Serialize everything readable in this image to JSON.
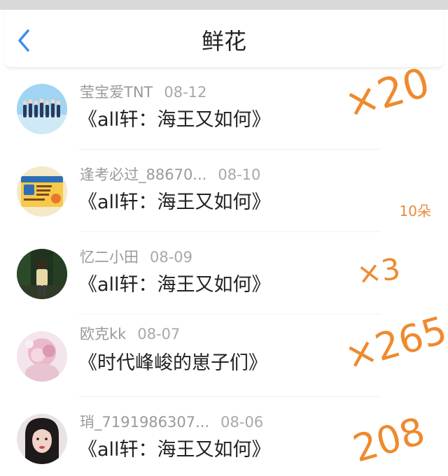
{
  "header": {
    "title": "鲜花",
    "back_icon": "chevron-left-icon"
  },
  "colors": {
    "accent_blue": "#3a8ef0",
    "annotation_orange": "#ef8a2e",
    "quantity_orange": "#e98a3a"
  },
  "items": [
    {
      "user": "莹宝爱TNT",
      "date": "08-12",
      "book": "《all轩：海王又如何》",
      "quantity": "",
      "annotation": "×20",
      "avatar": "group-photo-avatar"
    },
    {
      "user": "逢考必过_88670...",
      "date": "08-10",
      "book": "《all轩：海王又如何》",
      "quantity": "10朵",
      "annotation": "",
      "avatar": "sticker-avatar"
    },
    {
      "user": "忆二小田",
      "date": "08-09",
      "book": "《all轩：海王又如何》",
      "quantity": "",
      "annotation": "×3",
      "avatar": "forest-person-avatar"
    },
    {
      "user": "欧克kk",
      "date": "08-07",
      "book": "《时代峰峻的崽子们》",
      "quantity": "",
      "annotation": "×265",
      "avatar": "pink-illustration-avatar"
    },
    {
      "user": "琑_7191986307...",
      "date": "08-06",
      "book": "《all轩：海王又如何》",
      "quantity": "",
      "annotation": "208",
      "avatar": "girl-portrait-avatar"
    }
  ]
}
